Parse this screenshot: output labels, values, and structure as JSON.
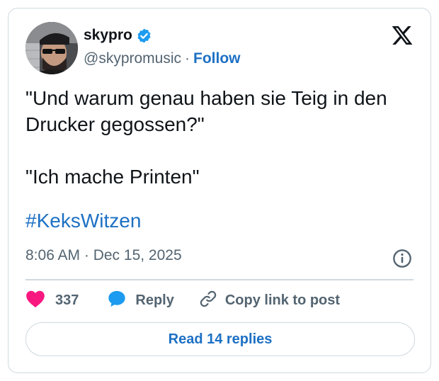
{
  "author": {
    "display_name": "skypro",
    "handle": "@skypromusic",
    "separator": "·",
    "follow_label": "Follow",
    "verified_color": "#1d9bf0"
  },
  "tweet": {
    "lines": [
      "\"Und warum genau haben sie Teig in den Drucker gegossen?\"",
      "\"Ich mache Printen\""
    ],
    "hashtag": "#KeksWitzen",
    "timestamp": "8:06 AM · Dec 15, 2025"
  },
  "actions": {
    "like_count": "337",
    "reply_label": "Reply",
    "copy_link_label": "Copy link to post"
  },
  "read_replies_label": "Read 14 replies",
  "icons": {
    "logo": "x-logo-icon",
    "verified": "verified-badge-icon",
    "info": "info-icon",
    "like": "heart-icon",
    "reply": "speech-bubble-icon",
    "copy": "link-icon"
  },
  "colors": {
    "accent": "#1d70c4",
    "heart": "#f91880",
    "muted": "#536471",
    "border": "#cfd9de"
  }
}
